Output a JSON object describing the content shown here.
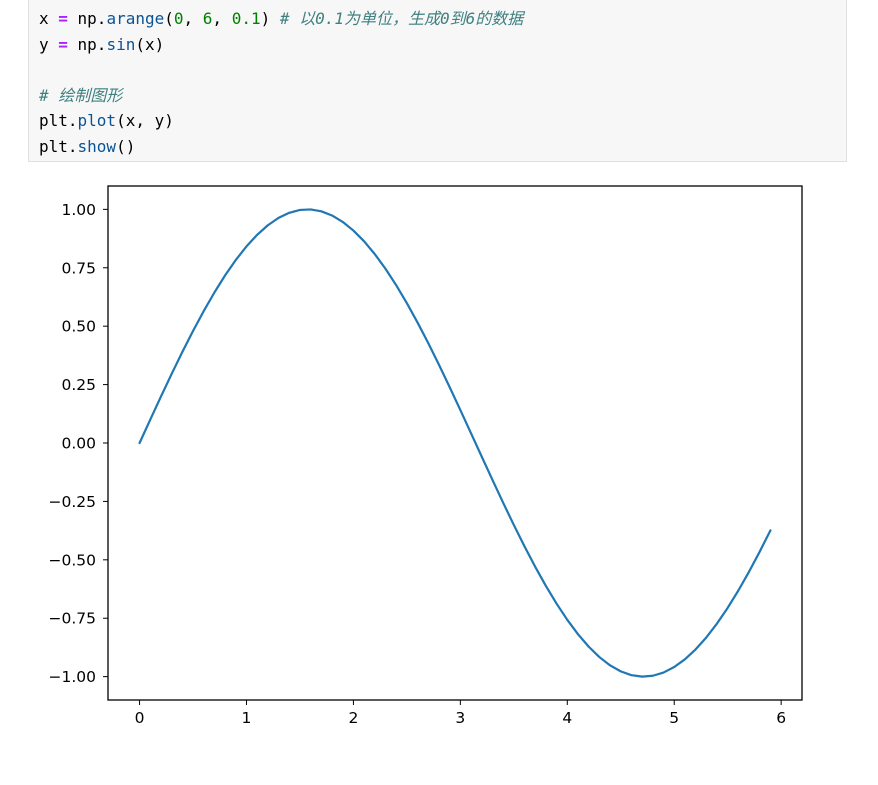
{
  "code_cell": {
    "lines": [
      {
        "tokens": [
          {
            "t": "x ",
            "k": "plain"
          },
          {
            "t": "=",
            "k": "op"
          },
          {
            "t": " np.",
            "k": "plain"
          },
          {
            "t": "arange",
            "k": "attr"
          },
          {
            "t": "(",
            "k": "plain"
          },
          {
            "t": "0",
            "k": "num"
          },
          {
            "t": ", ",
            "k": "plain"
          },
          {
            "t": "6",
            "k": "num"
          },
          {
            "t": ", ",
            "k": "plain"
          },
          {
            "t": "0.1",
            "k": "num"
          },
          {
            "t": ") ",
            "k": "plain"
          },
          {
            "t": "# 以0.1为单位，生成0到6的数据",
            "k": "comment"
          }
        ]
      },
      {
        "tokens": [
          {
            "t": "y ",
            "k": "plain"
          },
          {
            "t": "=",
            "k": "op"
          },
          {
            "t": " np.",
            "k": "plain"
          },
          {
            "t": "sin",
            "k": "attr"
          },
          {
            "t": "(x)",
            "k": "plain"
          }
        ]
      },
      {
        "tokens": []
      },
      {
        "tokens": [
          {
            "t": "# 绘制图形",
            "k": "comment"
          }
        ]
      },
      {
        "tokens": [
          {
            "t": "plt.",
            "k": "plain"
          },
          {
            "t": "plot",
            "k": "attr"
          },
          {
            "t": "(x, y)",
            "k": "plain"
          }
        ]
      },
      {
        "tokens": [
          {
            "t": "plt.",
            "k": "plain"
          },
          {
            "t": "show",
            "k": "attr"
          },
          {
            "t": "()",
            "k": "plain"
          }
        ]
      }
    ]
  },
  "chart_data": {
    "type": "line",
    "title": "",
    "xlabel": "",
    "ylabel": "",
    "xlim": [
      -0.295,
      6.195
    ],
    "ylim": [
      -1.1,
      1.1
    ],
    "grid": false,
    "legend": "none",
    "line_color": "#1f77b4",
    "xticks": [
      0,
      1,
      2,
      3,
      4,
      5,
      6
    ],
    "xtick_labels": [
      "0",
      "1",
      "2",
      "3",
      "4",
      "5",
      "6"
    ],
    "yticks": [
      1.0,
      0.75,
      0.5,
      0.25,
      0.0,
      -0.25,
      -0.5,
      -0.75,
      -1.0
    ],
    "ytick_labels": [
      "1.00",
      "0.75",
      "0.50",
      "0.25",
      "0.00",
      "−0.25",
      "−0.50",
      "−0.75",
      "−1.00"
    ],
    "series": [
      {
        "x": [
          0.0,
          0.1,
          0.2,
          0.3,
          0.4,
          0.5,
          0.6,
          0.7,
          0.8,
          0.9,
          1.0,
          1.1,
          1.2,
          1.3,
          1.4,
          1.5,
          1.6,
          1.7,
          1.8,
          1.9,
          2.0,
          2.1,
          2.2,
          2.3,
          2.4,
          2.5,
          2.6,
          2.7,
          2.8,
          2.9,
          3.0,
          3.1,
          3.2,
          3.3,
          3.4,
          3.5,
          3.6,
          3.7,
          3.8,
          3.9,
          4.0,
          4.1,
          4.2,
          4.3,
          4.4,
          4.5,
          4.6,
          4.7,
          4.8,
          4.9,
          5.0,
          5.1,
          5.2,
          5.3,
          5.4,
          5.5,
          5.6,
          5.7,
          5.8,
          5.9
        ],
        "y": [
          0.0,
          0.0998,
          0.1987,
          0.2955,
          0.3894,
          0.4794,
          0.5646,
          0.6442,
          0.7174,
          0.7833,
          0.8415,
          0.8912,
          0.932,
          0.9636,
          0.9854,
          0.9975,
          0.9996,
          0.9917,
          0.9738,
          0.9463,
          0.9093,
          0.8632,
          0.8085,
          0.7457,
          0.6755,
          0.5985,
          0.5155,
          0.4274,
          0.335,
          0.2392,
          0.1411,
          0.0416,
          -0.0584,
          -0.1577,
          -0.2555,
          -0.3508,
          -0.4425,
          -0.5298,
          -0.6119,
          -0.6878,
          -0.7568,
          -0.8183,
          -0.8716,
          -0.9162,
          -0.9516,
          -0.9775,
          -0.9937,
          -0.9999,
          -0.9962,
          -0.9825,
          -0.9589,
          -0.9258,
          -0.8835,
          -0.8323,
          -0.7728,
          -0.7055,
          -0.6313,
          -0.5507,
          -0.4646,
          -0.3739
        ]
      }
    ]
  }
}
